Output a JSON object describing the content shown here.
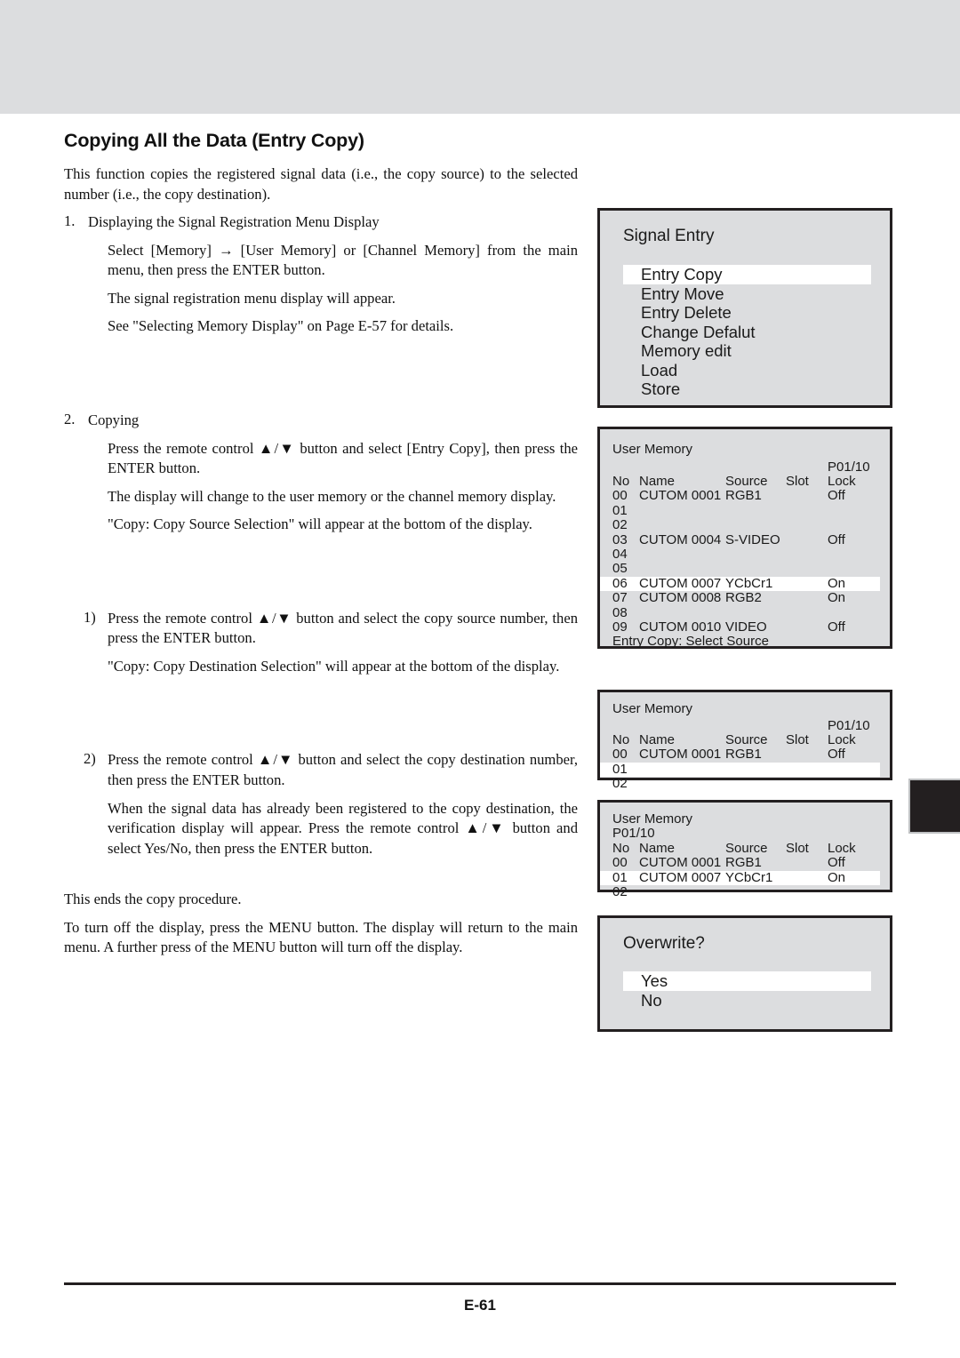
{
  "page": {
    "title": "Copying All the Data (Entry Copy)",
    "intro": "This function copies the registered signal data (i.e., the copy source) to the selected number (i.e., the copy destination).",
    "ending_1": "This ends the copy procedure.",
    "ending_2": "To turn off the display, press the MENU button. The display will return to the main menu. A further press of the MENU button will turn off the display.",
    "footer_page_number": "E-61"
  },
  "steps": [
    {
      "num": "1.",
      "head": "Displaying the Signal Registration Menu Display",
      "subs": [
        "Select [Memory] → [User Memory] or [Channel Memory] from the main menu, then press the ENTER button.",
        "The signal registration menu display will appear.",
        "See \"Selecting Memory Display\" on Page E-57 for details."
      ]
    },
    {
      "num": "2.",
      "head": "Copying",
      "subs": [
        "Press the remote control ▲/▼ button and select [Entry Copy], then press the ENTER button.",
        "The display will change to the user memory or the channel memory display.",
        "\"Copy: Copy Source Selection\" will appear at the bottom of the display."
      ]
    }
  ],
  "substeps": [
    {
      "num": "1)",
      "head": "Press the remote control ▲/▼ button and select the copy source number, then press the ENTER button.",
      "note": "\"Copy: Copy Destination Selection\" will appear at the bottom of the display."
    },
    {
      "num": "2)",
      "head": "Press the remote control ▲/▼ button and select the copy destination number, then press the ENTER button.",
      "note": "When the signal data has already been registered to the copy destination, the verification display will appear. Press the remote control ▲/▼ button and select Yes/No, then press the ENTER button."
    }
  ],
  "signal_entry": {
    "title": "Signal Entry",
    "items": [
      {
        "label": "Entry Copy",
        "selected": true
      },
      {
        "label": "Entry Move",
        "selected": false
      },
      {
        "label": "Entry Delete",
        "selected": false
      },
      {
        "label": "Change Defalut",
        "selected": false
      },
      {
        "label": "Memory edit",
        "selected": false
      },
      {
        "label": "Load",
        "selected": false
      },
      {
        "label": "Store",
        "selected": false
      }
    ]
  },
  "memory_tables": [
    {
      "title": "User Memory",
      "page_indicator": "P01/10",
      "page_indicator_position": "right",
      "columns": {
        "no": "No",
        "name": "Name",
        "source": "Source",
        "slot": "Slot",
        "lock": "Lock"
      },
      "rows": [
        {
          "no": "00",
          "name": "CUTOM 0001",
          "source": "RGB1",
          "slot": "",
          "lock": "Off",
          "selected": false
        },
        {
          "no": "01",
          "name": "",
          "source": "",
          "slot": "",
          "lock": "",
          "selected": false
        },
        {
          "no": "02",
          "name": "",
          "source": "",
          "slot": "",
          "lock": "",
          "selected": false
        },
        {
          "no": "03",
          "name": "CUTOM 0004",
          "source": "S-VIDEO",
          "slot": "",
          "lock": "Off",
          "selected": false
        },
        {
          "no": "04",
          "name": "",
          "source": "",
          "slot": "",
          "lock": "",
          "selected": false
        },
        {
          "no": "05",
          "name": "",
          "source": "",
          "slot": "",
          "lock": "",
          "selected": false
        },
        {
          "no": "06",
          "name": "CUTOM 0007",
          "source": "YCbCr1",
          "slot": "",
          "lock": "On",
          "selected": true
        },
        {
          "no": "07",
          "name": "CUTOM 0008",
          "source": "RGB2",
          "slot": "",
          "lock": "On",
          "selected": false
        },
        {
          "no": "08",
          "name": "",
          "source": "",
          "slot": "",
          "lock": "",
          "selected": false
        },
        {
          "no": "09",
          "name": "CUTOM 0010",
          "source": "VIDEO",
          "slot": "",
          "lock": "Off",
          "selected": false
        }
      ],
      "status": "Entry Copy: Select Source"
    },
    {
      "title": "User Memory",
      "page_indicator": "P01/10",
      "page_indicator_position": "right",
      "columns": {
        "no": "No",
        "name": "Name",
        "source": "Source",
        "slot": "Slot",
        "lock": "Lock"
      },
      "rows": [
        {
          "no": "00",
          "name": "CUTOM 0001",
          "source": "RGB1",
          "slot": "",
          "lock": "Off",
          "selected": false
        },
        {
          "no": "01",
          "name": "",
          "source": "",
          "slot": "",
          "lock": "",
          "selected": true
        },
        {
          "no": "02",
          "name": "",
          "source": "",
          "slot": "",
          "lock": "",
          "selected": false
        }
      ],
      "status": ""
    },
    {
      "title": "User Memory",
      "page_indicator": "P01/10",
      "page_indicator_position": "left",
      "columns": {
        "no": "No",
        "name": "Name",
        "source": "Source",
        "slot": "Slot",
        "lock": "Lock"
      },
      "rows": [
        {
          "no": "00",
          "name": "CUTOM 0001",
          "source": "RGB1",
          "slot": "",
          "lock": "Off",
          "selected": false
        },
        {
          "no": "01",
          "name": "CUTOM 0007",
          "source": "YCbCr1",
          "slot": "",
          "lock": "On",
          "selected": true
        },
        {
          "no": "02",
          "name": "",
          "source": "",
          "slot": "",
          "lock": "",
          "selected": false
        }
      ],
      "status": ""
    }
  ],
  "overwrite_dialog": {
    "title": "Overwrite?",
    "items": [
      {
        "label": "Yes",
        "selected": true
      },
      {
        "label": "No",
        "selected": false
      }
    ]
  },
  "colors": {
    "osd_background": "#dcdddf",
    "osd_border": "#231f20",
    "osd_highlight": "#ffffff",
    "band": "#dcdddf",
    "tab_marker": "#231f20"
  }
}
